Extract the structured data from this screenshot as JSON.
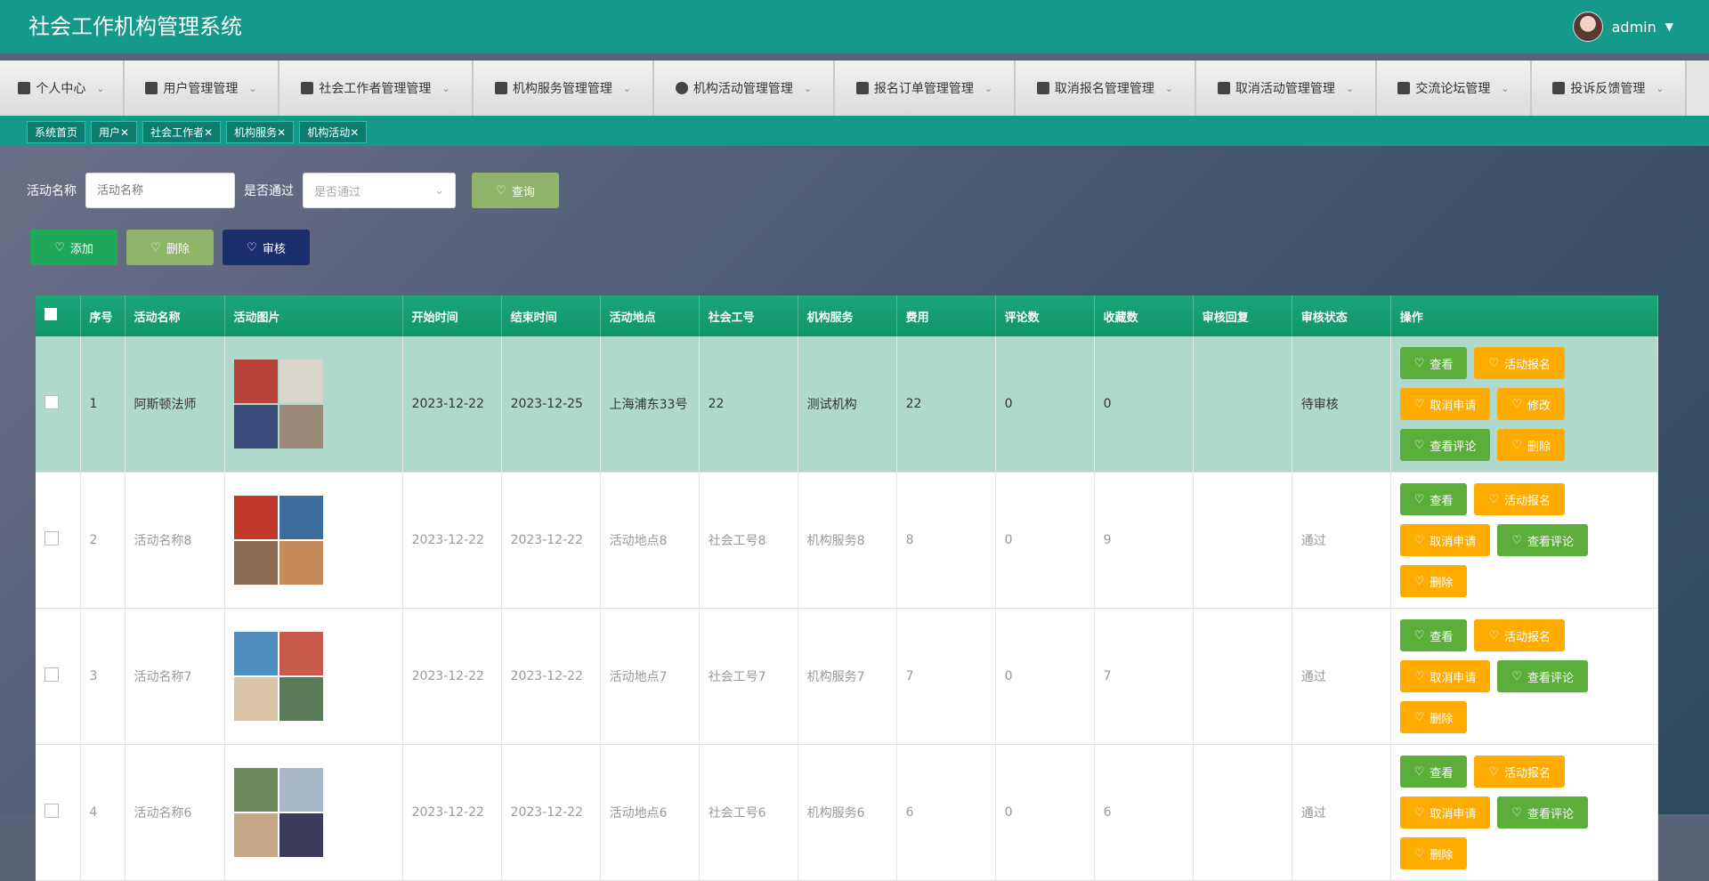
{
  "app": {
    "title": "社会工作机构管理系统",
    "username": "admin"
  },
  "nav": [
    {
      "label": "个人中心",
      "icon": "calendar-icon"
    },
    {
      "label": "用户管理管理",
      "icon": "chat-icon"
    },
    {
      "label": "社会工作者管理管理",
      "icon": "person-icon"
    },
    {
      "label": "机构服务管理管理",
      "icon": "grid-icon"
    },
    {
      "label": "机构活动管理管理",
      "icon": "bulb-icon"
    },
    {
      "label": "报名订单管理管理",
      "icon": "sliders-icon"
    },
    {
      "label": "取消报名管理管理",
      "icon": "monitor-icon"
    },
    {
      "label": "取消活动管理管理",
      "icon": "grid-icon"
    },
    {
      "label": "交流论坛管理",
      "icon": "grid-icon"
    },
    {
      "label": "投诉反馈管理",
      "icon": "clipboard-icon"
    }
  ],
  "tags": [
    "系统首页",
    "用户✕",
    "社会工作者✕",
    "机构服务✕",
    "机构活动✕"
  ],
  "search": {
    "name_label": "活动名称",
    "name_placeholder": "活动名称",
    "pass_label": "是否通过",
    "pass_placeholder": "是否通过",
    "query_label": "查询"
  },
  "actions": {
    "add": "添加",
    "delete": "删除",
    "audit": "审核"
  },
  "table": {
    "headers": [
      "序号",
      "活动名称",
      "活动图片",
      "开始时间",
      "结束时间",
      "活动地点",
      "社会工号",
      "机构服务",
      "费用",
      "评论数",
      "收藏数",
      "审核回复",
      "审核状态",
      "操作"
    ],
    "rows": [
      {
        "idx": "1",
        "name": "阿斯顿法师",
        "start": "2023-12-22",
        "end": "2023-12-25",
        "place": "上海浦东33号",
        "worker_id": "22",
        "service": "测试机构",
        "fee": "22",
        "comments": "0",
        "favorites": "0",
        "reply": "",
        "status": "待审核",
        "ops": [
          "查看",
          "活动报名",
          "取消申请",
          "修改",
          "查看评论",
          "删除"
        ]
      },
      {
        "idx": "2",
        "name": "活动名称8",
        "start": "2023-12-22",
        "end": "2023-12-22",
        "place": "活动地点8",
        "worker_id": "社会工号8",
        "service": "机构服务8",
        "fee": "8",
        "comments": "0",
        "favorites": "9",
        "reply": "",
        "status": "通过",
        "ops": [
          "查看",
          "活动报名",
          "取消申请",
          "查看评论",
          "删除"
        ]
      },
      {
        "idx": "3",
        "name": "活动名称7",
        "start": "2023-12-22",
        "end": "2023-12-22",
        "place": "活动地点7",
        "worker_id": "社会工号7",
        "service": "机构服务7",
        "fee": "7",
        "comments": "0",
        "favorites": "7",
        "reply": "",
        "status": "通过",
        "ops": [
          "查看",
          "活动报名",
          "取消申请",
          "查看评论",
          "删除"
        ]
      },
      {
        "idx": "4",
        "name": "活动名称6",
        "start": "2023-12-22",
        "end": "2023-12-22",
        "place": "活动地点6",
        "worker_id": "社会工号6",
        "service": "机构服务6",
        "fee": "6",
        "comments": "0",
        "favorites": "6",
        "reply": "",
        "status": "通过",
        "ops": [
          "查看",
          "活动报名",
          "取消申请",
          "查看评论",
          "删除"
        ]
      }
    ]
  },
  "colors": {
    "teal": "#14998b",
    "green": "#5cae3a",
    "orange": "#ffab00",
    "navy": "#1a2e6b"
  }
}
